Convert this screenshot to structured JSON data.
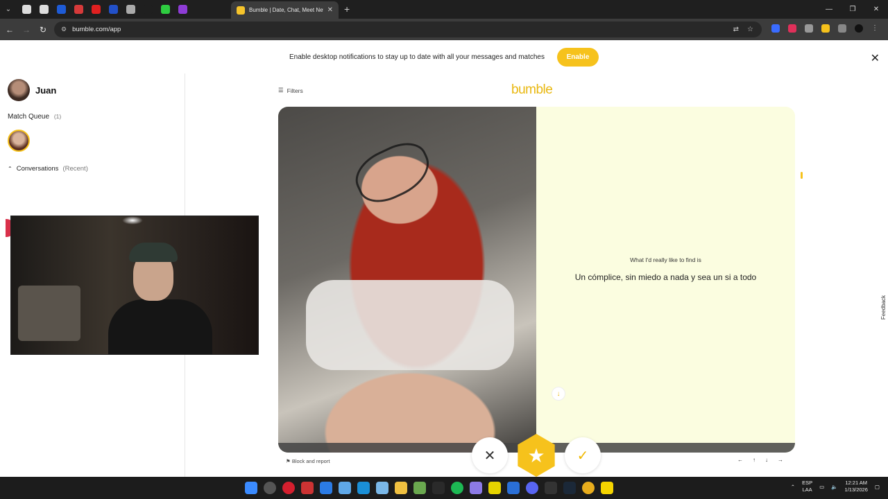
{
  "browser": {
    "active_tab_title": "Bumble | Date, Chat, Meet New",
    "url": "bumble.com/app"
  },
  "notification": {
    "text": "Enable desktop notifications to stay up to date with all your messages and matches",
    "button": "Enable"
  },
  "sidebar": {
    "user_name": "Juan",
    "match_queue_label": "Match Queue",
    "match_queue_count": "(1)",
    "conversations_label": "Conversations",
    "conversations_filter": "(Recent)"
  },
  "main": {
    "filters_label": "Filters",
    "logo": "bumble",
    "bio_label": "What I'd really like to find is",
    "bio_text": "Un cómplice, sin miedo a nada y sea un si a todo",
    "block_report": "Block and report",
    "nav_keys": [
      "←",
      "↑",
      "↓",
      "→"
    ],
    "feedback": "Feedback"
  },
  "taskbar": {
    "lang_top": "ESP",
    "lang_bottom": "LAA",
    "time": "12:21 AM",
    "date": "1/13/2026"
  },
  "colors": {
    "accent": "#f6c21c",
    "bio_bg": "#fbfde0"
  }
}
